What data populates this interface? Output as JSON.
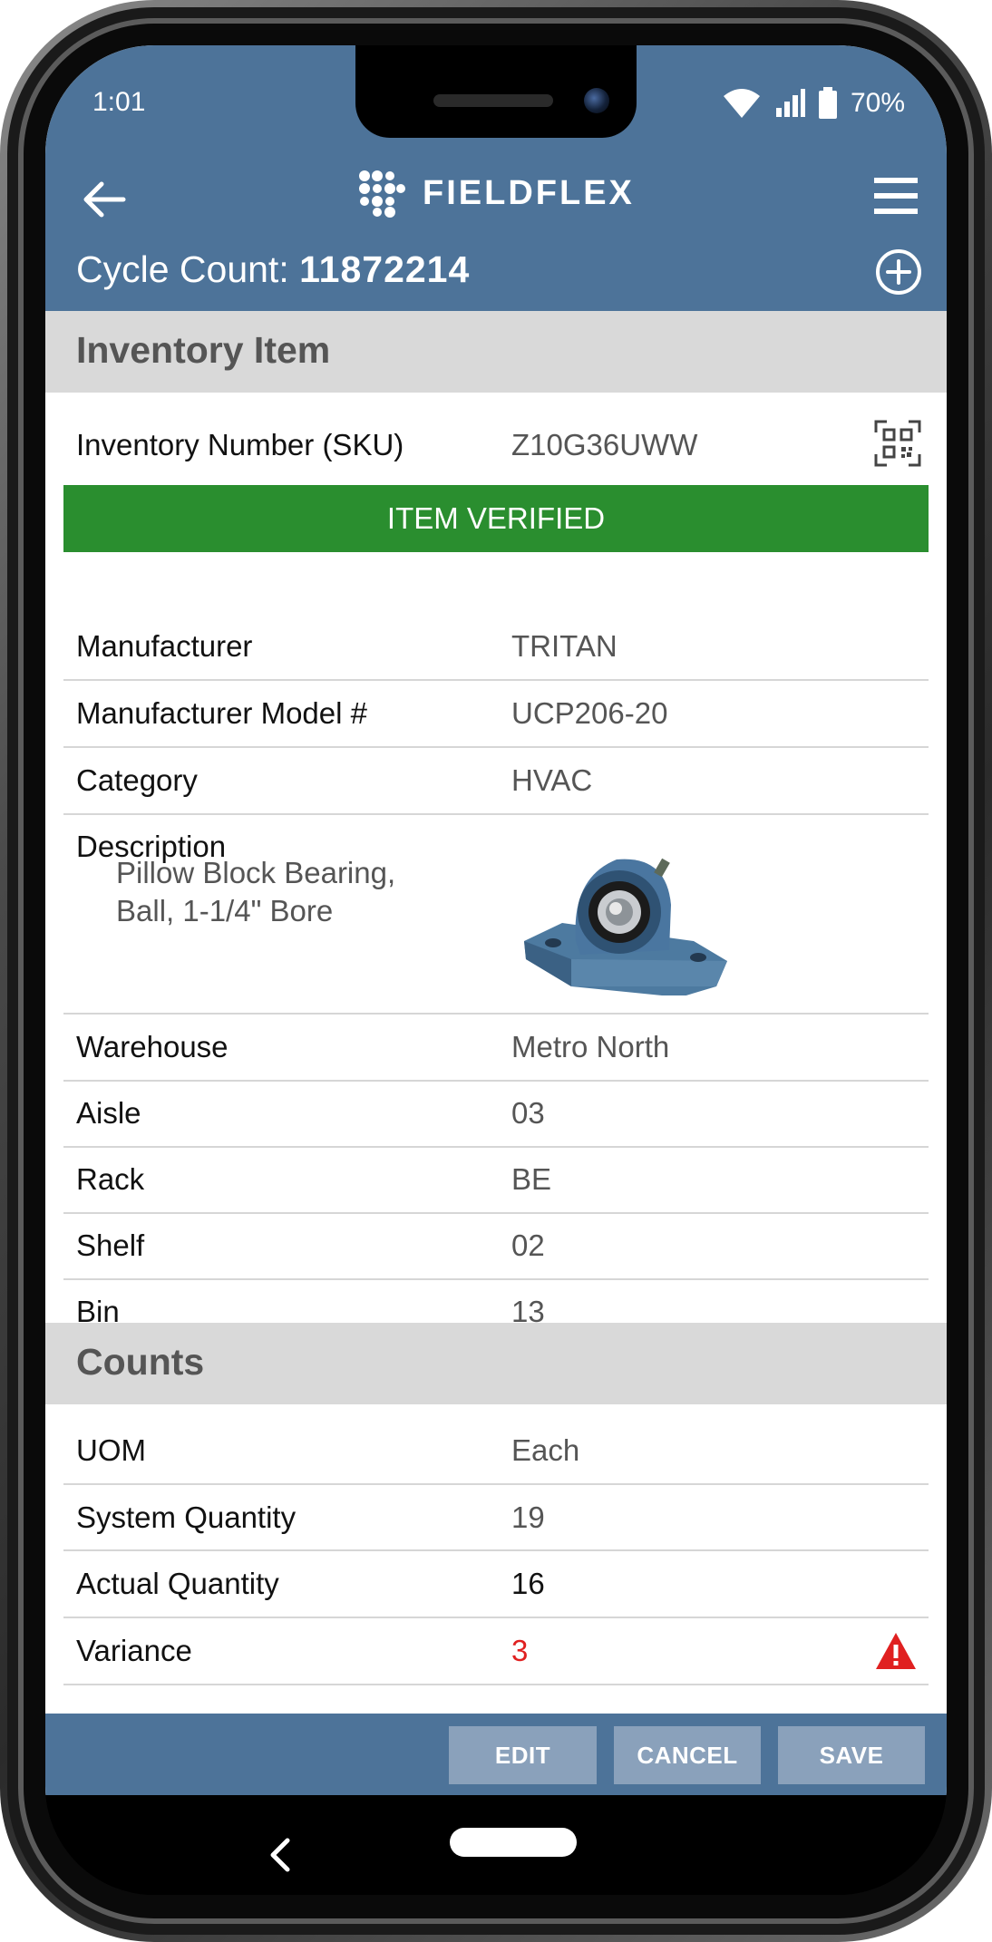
{
  "status_bar": {
    "time": "1:01",
    "battery": "70%"
  },
  "header": {
    "logo_text": "FIELDFLEX",
    "title_prefix": "Cycle Count:",
    "cycle_number": "11872214"
  },
  "inventory": {
    "section_title": "Inventory Item",
    "sku_label": "Inventory Number (SKU)",
    "sku_value": "Z10G36UWW",
    "verified_banner": "ITEM VERIFIED",
    "rows": [
      {
        "label": "Manufacturer",
        "value": "TRITAN"
      },
      {
        "label": "Manufacturer Model #",
        "value": "UCP206-20"
      },
      {
        "label": "Category",
        "value": "HVAC"
      }
    ],
    "description_label": "Description",
    "description_value": "Pillow Block Bearing, Ball, 1-1/4\" Bore",
    "location_rows": [
      {
        "label": "Warehouse",
        "value": "Metro North"
      },
      {
        "label": "Aisle",
        "value": "03"
      },
      {
        "label": "Rack",
        "value": "BE"
      },
      {
        "label": "Shelf",
        "value": "02"
      },
      {
        "label": "Bin",
        "value": "13"
      }
    ]
  },
  "counts": {
    "section_title": "Counts",
    "rows": [
      {
        "label": "UOM",
        "value": "Each"
      },
      {
        "label": "System Quantity",
        "value": "19"
      },
      {
        "label": "Actual Quantity",
        "value": "16"
      },
      {
        "label": "Variance",
        "value": "3"
      }
    ]
  },
  "actions": {
    "edit": "EDIT",
    "cancel": "CANCEL",
    "save": "SAVE"
  },
  "colors": {
    "brand_blue": "#4d7399",
    "verified_green": "#2a8e2f",
    "variance_red": "#e02020",
    "button_fill": "#8aa1bb"
  }
}
